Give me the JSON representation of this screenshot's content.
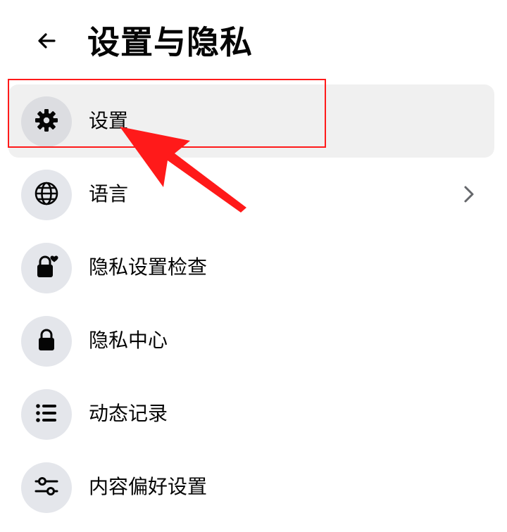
{
  "header": {
    "title": "设置与隐私",
    "back_icon": "arrow-left-icon"
  },
  "menu": {
    "items": [
      {
        "label": "设置",
        "icon": "gear-icon",
        "active": true
      },
      {
        "label": "语言",
        "icon": "globe-icon",
        "has_chevron": true
      },
      {
        "label": "隐私设置检查",
        "icon": "lock-heart-icon"
      },
      {
        "label": "隐私中心",
        "icon": "lock-icon"
      },
      {
        "label": "动态记录",
        "icon": "list-icon"
      },
      {
        "label": "内容偏好设置",
        "icon": "sliders-icon"
      }
    ]
  },
  "annotation": {
    "highlight_color": "#ff1a1a",
    "arrow_color": "#ff1a1a",
    "target": "设置"
  },
  "colors": {
    "text": "#050505",
    "icon_bg": "#e4e6eb",
    "active_row_bg": "#f0f0f0",
    "chevron": "#65676b"
  }
}
